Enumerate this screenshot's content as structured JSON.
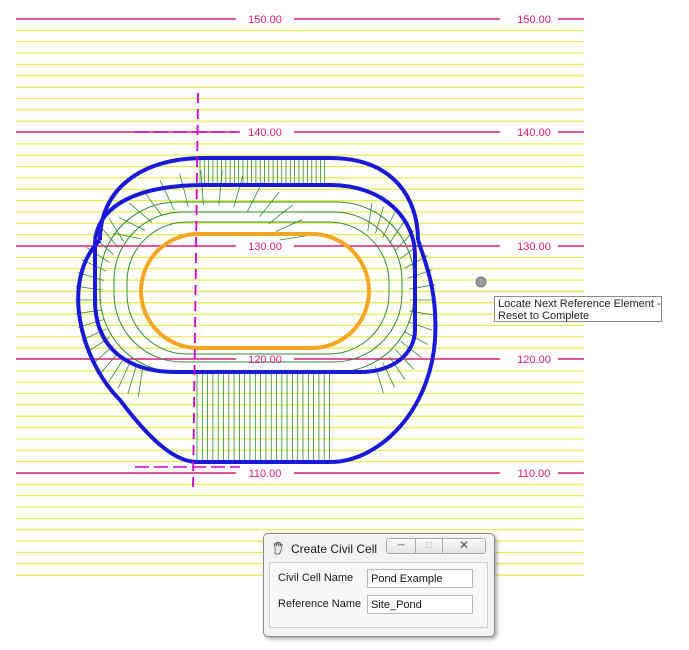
{
  "canvas": {
    "contour_labels": [
      "150.00",
      "140.00",
      "130.00",
      "120.00",
      "110.00"
    ],
    "colors": {
      "minor_contour": "#e8e84a",
      "major_contour": "#dd1a7a",
      "pond_outline": "#1a1ad6",
      "pond_bottom": "#f5a623",
      "inner_contour": "#2e8b2e",
      "reference_line": "#cc00cc",
      "cursor_dot": "#9a9a9a"
    }
  },
  "tooltip": {
    "line1": "Locate Next Reference Element -",
    "line2": "Reset to Complete"
  },
  "dialog": {
    "title": "Create Civil Cell",
    "icon": "civil-cell-hand-icon",
    "fields": [
      {
        "label": "Civil Cell Name",
        "value": "Pond Example"
      },
      {
        "label": "Reference Name",
        "value": "Site_Pond"
      }
    ],
    "buttons": {
      "minimize": "minimize-icon",
      "maximize": "maximize-icon",
      "close": "close-icon"
    }
  }
}
